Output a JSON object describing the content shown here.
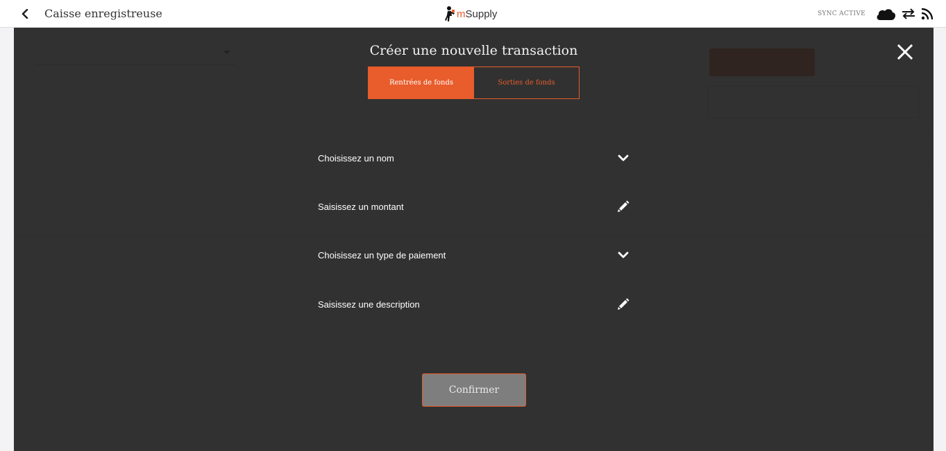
{
  "header": {
    "title": "Caisse enregistreuse",
    "brand_prefix": "m",
    "brand_name": "Supply",
    "sync_label": "SYNC ACTIVE",
    "icons": [
      "back-chevron-icon",
      "cloud-icon",
      "sync-arrows-icon",
      "rss-icon"
    ]
  },
  "modal": {
    "title": "Créer une nouvelle transaction",
    "tabs": [
      {
        "label": "Rentrées de fonds",
        "active": true
      },
      {
        "label": "Sorties de fonds",
        "active": false
      }
    ],
    "fields": [
      {
        "label": "Choisissez un nom",
        "icon": "chevron-down-icon"
      },
      {
        "label": "Saisissez un montant",
        "icon": "pencil-icon"
      },
      {
        "label": "Choisissez un type de paiement",
        "icon": "chevron-down-icon"
      },
      {
        "label": "Saisissez une description",
        "icon": "pencil-icon"
      }
    ],
    "confirm_label": "Confirmer"
  },
  "colors": {
    "accent": "#e95c2b",
    "overlay": "#202020",
    "confirm_bg": "#7e7e7e"
  }
}
